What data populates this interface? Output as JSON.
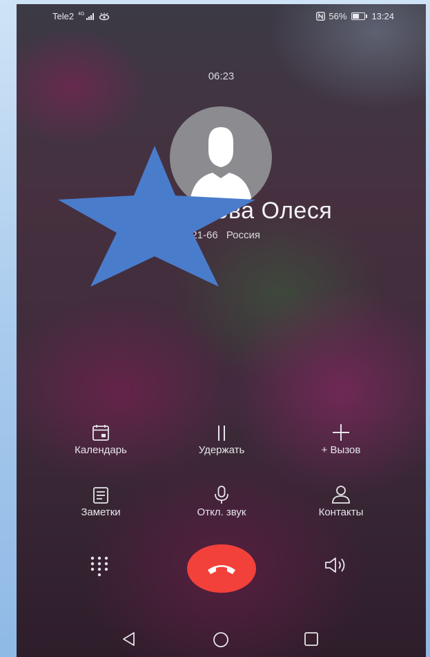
{
  "status": {
    "carrier": "Tele2",
    "network": "4G",
    "battery": "56%",
    "time": "13:24"
  },
  "call": {
    "duration": "06:23",
    "name": "Пу           ова Олеся",
    "number": "0-21-66",
    "region": "Россия"
  },
  "controls": [
    {
      "label": "Календарь",
      "icon": "calendar-icon"
    },
    {
      "label": "Удержать",
      "icon": "pause-icon"
    },
    {
      "label": "+ Вызов",
      "icon": "plus-icon"
    },
    {
      "label": "Заметки",
      "icon": "notes-icon"
    },
    {
      "label": "Откл. звук",
      "icon": "microphone-icon"
    },
    {
      "label": "Контакты",
      "icon": "contacts-icon"
    }
  ],
  "dock": {
    "left_icon": "dialpad-icon",
    "center_icon": "hang-up-icon",
    "right_icon": "speaker-icon"
  },
  "nav": {
    "back": "back-icon",
    "home": "home-icon",
    "recents": "recents-icon"
  },
  "colors": {
    "end_call": "#f2413a",
    "star": "#4a7ccc",
    "text": "#e6e6ea"
  }
}
